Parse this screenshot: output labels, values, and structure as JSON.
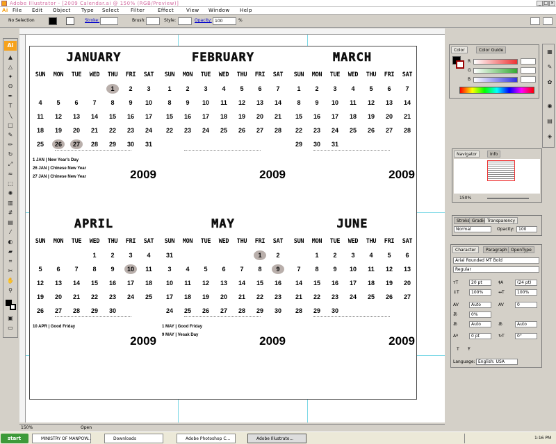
{
  "window": {
    "title": "Adobe Illustrator - [2009 Calendar.ai @ 150% (RGB/Preview)]"
  },
  "menu": [
    "File",
    "Edit",
    "Object",
    "Type",
    "Select",
    "Filter",
    "Effect",
    "View",
    "Window",
    "Help"
  ],
  "control_bar": {
    "selection": "No Selection",
    "stroke_label": "Stroke:",
    "brush_label": "Brush:",
    "style_label": "Style:",
    "opacity_label": "Opacity:",
    "opacity_value": "100",
    "opacity_unit": "%"
  },
  "calendar": {
    "months": [
      {
        "name": "JANUARY",
        "year": "2009",
        "first": 4,
        "days": 31,
        "highlight": [
          1,
          26,
          27
        ],
        "holidays": [
          "1 JAN | New Year's Day",
          "26 JAN | Chinese New Year",
          "27 JAN | Chinese New Year"
        ]
      },
      {
        "name": "FEBRUARY",
        "year": "2009",
        "first": 0,
        "days": 28,
        "highlight": [],
        "holidays": []
      },
      {
        "name": "MARCH",
        "year": "2009",
        "first": 0,
        "days": 31,
        "highlight": [],
        "holidays": []
      },
      {
        "name": "APRIL",
        "year": "2009",
        "first": 3,
        "days": 30,
        "highlight": [
          10
        ],
        "holidays": [
          "10 APR | Good Friday"
        ]
      },
      {
        "name": "MAY",
        "year": "2009",
        "first": 5,
        "days": 31,
        "highlight": [
          1,
          9
        ],
        "holidays": [
          "1 MAY | Good Friday",
          "9 MAY | Vesak Day"
        ]
      },
      {
        "name": "JUNE",
        "year": "2009",
        "first": 1,
        "days": 30,
        "highlight": [],
        "holidays": []
      }
    ],
    "weekdays": [
      "SUN",
      "MON",
      "TUE",
      "WED",
      "THU",
      "FRI",
      "SAT"
    ]
  },
  "color_panel": {
    "tabs": [
      "Color",
      "Color Guide"
    ],
    "channels": [
      "R",
      "G",
      "B"
    ]
  },
  "navigator_panel": {
    "tabs": [
      "Navigator",
      "Info"
    ],
    "zoom": "150%"
  },
  "transparency_panel": {
    "tabs": [
      "Stroke",
      "Gradie",
      "Transparency"
    ],
    "blend_mode": "Normal",
    "opacity_label": "Opacity:",
    "opacity_value": "100"
  },
  "character_panel": {
    "tabs": [
      "Character",
      "Paragraph",
      "OpenType"
    ],
    "font": "Arial Rounded MT Bold",
    "style": "Regular",
    "size": "20 pt",
    "leading": "(24 pt)",
    "tracking": "Auto",
    "kerning": "0",
    "scale_h": "100%",
    "scale_v": "100%",
    "baseline": "0 pt",
    "rotation": "0°",
    "pct": "0%",
    "auto1": "Auto",
    "auto2": "Auto",
    "language_label": "Language:",
    "language": "English: USA"
  },
  "status_bar": {
    "zoom": "150%",
    "mode": "Open"
  },
  "taskbar": {
    "start": "start",
    "tasks": [
      "MINISTRY OF MANPOW...",
      "Downloads",
      "Adobe Photoshop C...",
      "Adobe Illustrato..."
    ],
    "clock": "1:16 PM"
  }
}
